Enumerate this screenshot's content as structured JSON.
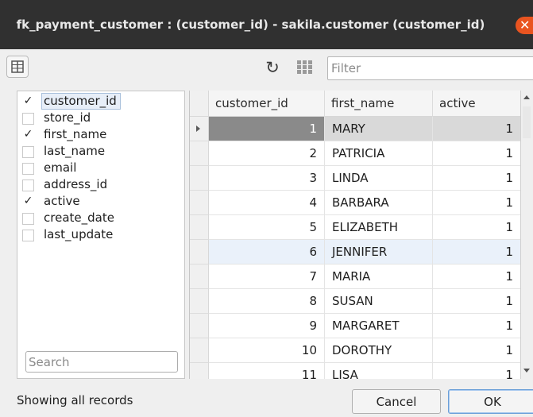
{
  "window": {
    "title": "fk_payment_customer : (customer_id) - sakila.customer (customer_id)"
  },
  "toolbar": {
    "filter_placeholder": "Filter",
    "refresh_icon": "refresh-icon",
    "grid_icon": "grid-icon",
    "panel_icon": "panel-toggle-icon"
  },
  "columns_panel": {
    "items": [
      {
        "label": "customer_id",
        "checked": true,
        "selected": true
      },
      {
        "label": "store_id",
        "checked": false
      },
      {
        "label": "first_name",
        "checked": true
      },
      {
        "label": "last_name",
        "checked": false
      },
      {
        "label": "email",
        "checked": false
      },
      {
        "label": "address_id",
        "checked": false
      },
      {
        "label": "active",
        "checked": true
      },
      {
        "label": "create_date",
        "checked": false
      },
      {
        "label": "last_update",
        "checked": false
      }
    ],
    "search_placeholder": "Search"
  },
  "table": {
    "headers": [
      "customer_id",
      "first_name",
      "active"
    ],
    "rows": [
      [
        "1",
        "MARY",
        "1"
      ],
      [
        "2",
        "PATRICIA",
        "1"
      ],
      [
        "3",
        "LINDA",
        "1"
      ],
      [
        "4",
        "BARBARA",
        "1"
      ],
      [
        "5",
        "ELIZABETH",
        "1"
      ],
      [
        "6",
        "JENNIFER",
        "1"
      ],
      [
        "7",
        "MARIA",
        "1"
      ],
      [
        "8",
        "SUSAN",
        "1"
      ],
      [
        "9",
        "MARGARET",
        "1"
      ],
      [
        "10",
        "DOROTHY",
        "1"
      ],
      [
        "11",
        "LISA",
        "1"
      ]
    ],
    "selected_row": 0,
    "highlighted_row": 5
  },
  "footer": {
    "status": "Showing all records",
    "cancel_label": "Cancel",
    "ok_label": "OK"
  },
  "colors": {
    "titlebar": "#303030",
    "close": "#e95420",
    "selected_cell": "#8a8a8a",
    "highlight_row": "#eaf1fa"
  }
}
